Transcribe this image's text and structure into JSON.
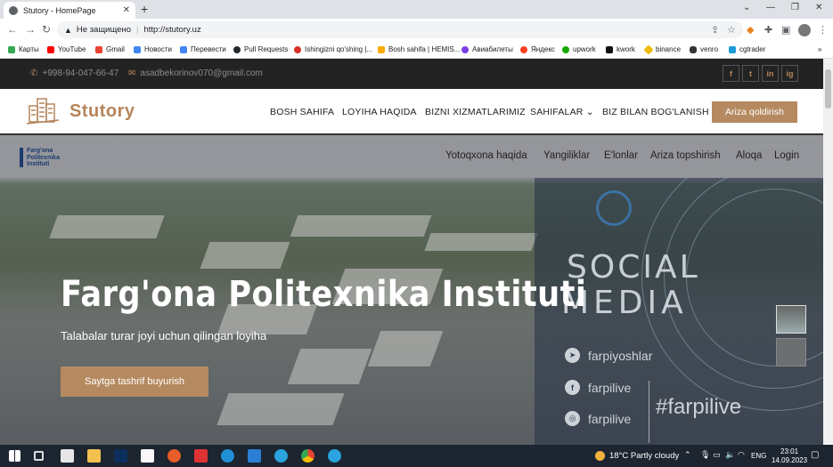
{
  "browser": {
    "tab_title": "Stutory - HomePage",
    "security_label": "Не защищено",
    "url": "http://stutory.uz",
    "bookmarks": [
      "Карты",
      "YouTube",
      "Gmail",
      "Новости",
      "Перевести",
      "Pull Requests",
      "Ishingizni qo'shing |...",
      "Bosh sahifa | HEMIS...",
      "Авиабилеты",
      "Яндекс",
      "upwork",
      "kwork",
      "binance",
      "venro",
      "cgtrader"
    ],
    "bookmark_colors": [
      "#34a853",
      "#ff0000",
      "#ea4335",
      "#4285f4",
      "#4285f4",
      "#24292e",
      "#d93025",
      "#f9ab00",
      "#7b3fe4",
      "#fc3f1d",
      "#14a800",
      "#111111",
      "#f0b90b",
      "#333333",
      "#1c9bd6"
    ]
  },
  "site": {
    "phone": "+998-94-047-66-47",
    "email": "asadbekorinov070@gmail.com",
    "social": [
      "f",
      "t",
      "in",
      "ig"
    ],
    "brand": "Stutory",
    "menu": [
      "BOSH SAHIFA",
      "LOYIHA HAQIDA",
      "BIZNI XIZMATLARIMIZ",
      "SAHIFALAR",
      "BIZ BILAN BOG'LANISH"
    ],
    "cta": "Ariza qoldirish",
    "accent": "#b58a60"
  },
  "hero": {
    "inner_logo_lines": [
      "Farg'ona",
      "Politexnika",
      "Instituti"
    ],
    "inner_nav": [
      "Yotoqxona haqida",
      "Yangiliklar",
      "E'lonlar",
      "Ariza topshirish",
      "Aloqa",
      "Login"
    ],
    "title": "Farg'ona Politexnika Instituti",
    "subtitle": "Talabalar turar joyi uchun qilingan loyiha",
    "button": "Saytga tashrif buyurish",
    "social_title1": "SOCIAL",
    "social_title2": "MEDIA",
    "social_lines": [
      "farpiyoshlar",
      "farpilive",
      "farpilive"
    ],
    "hashtag": "#farpilive"
  },
  "taskbar": {
    "weather": "18°C  Partly cloudy",
    "lang": "ENG",
    "time": "23:01",
    "date": "14.09.2023"
  }
}
